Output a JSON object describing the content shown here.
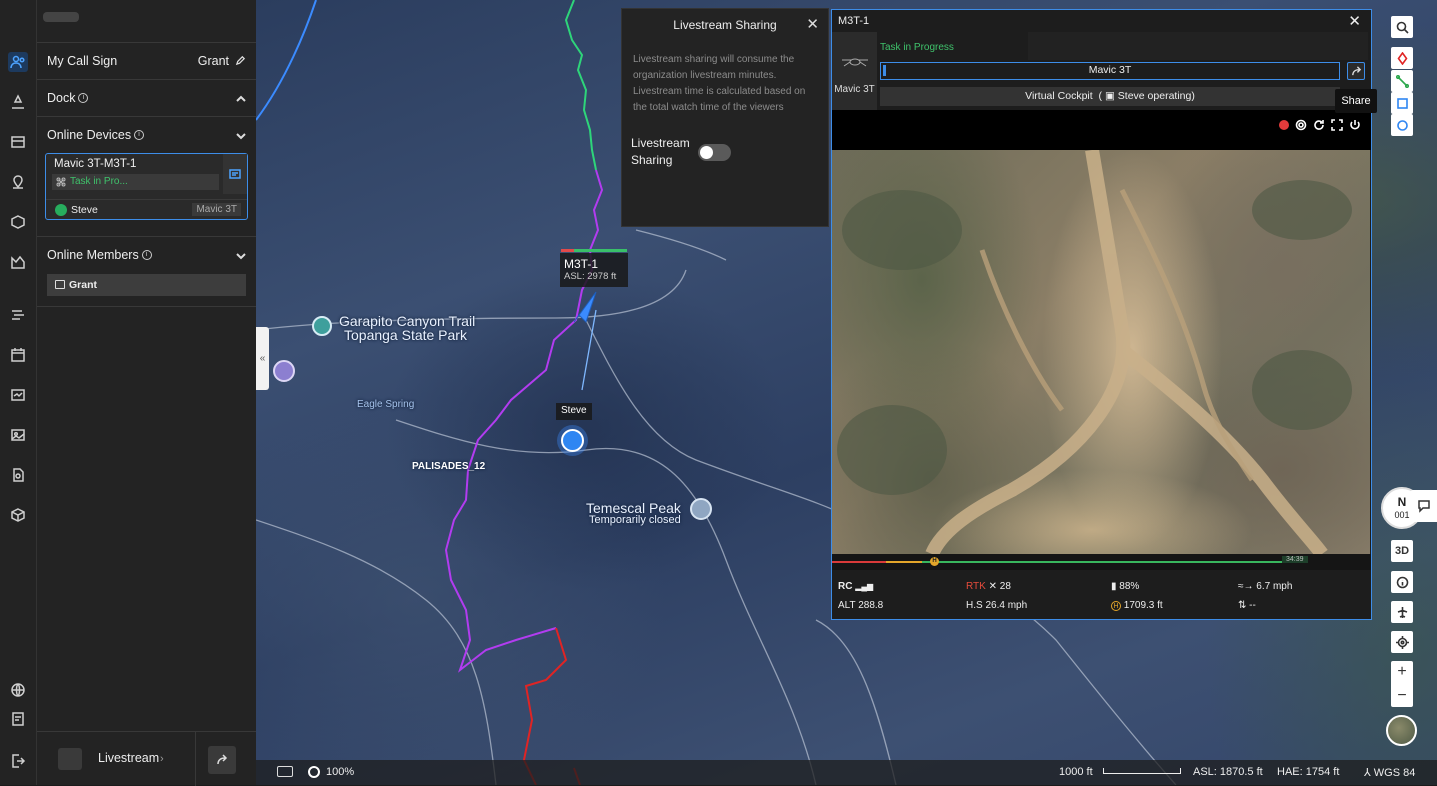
{
  "panel": {
    "call_sign_label": "My Call Sign",
    "call_sign_value": "Grant",
    "dock_label": "Dock",
    "online_devices_label": "Online Devices",
    "online_members_label": "Online Members",
    "device": {
      "name": "Mavic 3T-M3T-1",
      "task_status": "Task in Pro...",
      "pilot": "Steve",
      "model": "Mavic 3T"
    },
    "member": "Grant",
    "livestream_label": "Livestream"
  },
  "map": {
    "labels": {
      "trail_line1": "Garapito Canyon Trail",
      "trail_line2": "Topanga State Park",
      "eagle_spring": "Eagle Spring",
      "palisades": "PALISADES_12",
      "peak_line1": "Temescal Peak",
      "peak_line2": "Temporarily closed"
    },
    "drone_marker": {
      "name": "M3T-1",
      "asl": "ASL: 2978 ft"
    },
    "pilot_marker": "Steve"
  },
  "livestream_popup": {
    "title": "Livestream Sharing",
    "description": "Livestream sharing will consume the organization livestream minutes. Livestream time is calculated based on the total watch time of the viewers",
    "toggle_label": "Livestream Sharing",
    "toggle_on": false
  },
  "device_window": {
    "title": "M3T-1",
    "model_label": "Mavic 3T",
    "status": "Task in Progress",
    "model_bar": "Mavic 3T",
    "cockpit_label": "Virtual Cockpit",
    "cockpit_operator": "Steve operating)",
    "share_tooltip": "Share",
    "timeline_time": "34:39",
    "telemetry": {
      "rc_label": "RC",
      "rtk_label": "RTK",
      "rtk_sats": "28",
      "battery": "88%",
      "wind": "6.7 mph",
      "alt": "ALT 288.8",
      "hs": "H.S 26.4 mph",
      "home_dist": "1709.3 ft",
      "vs": "--"
    }
  },
  "compass": {
    "n": "N",
    "code": "001"
  },
  "toolbar": {
    "view_3d": "3D"
  },
  "bottom_bar": {
    "opacity": "100%",
    "scale": "1000 ft",
    "asl": "ASL: 1870.5 ft",
    "hae": "HAE: 1754 ft",
    "datum": "WGS 84"
  }
}
